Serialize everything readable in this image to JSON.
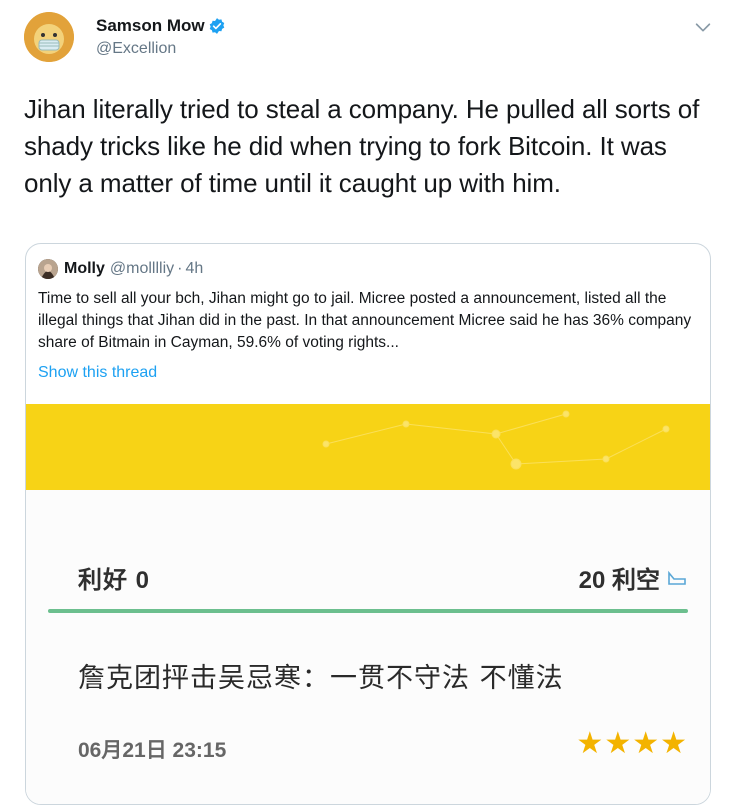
{
  "tweet": {
    "author_name": "Samson Mow",
    "author_handle": "@Excellion",
    "text": "Jihan literally tried to steal a company. He pulled all sorts of shady tricks like he did when trying to fork Bitcoin. It was only a matter of time until it caught up with him."
  },
  "quote": {
    "name": "Molly",
    "handle": "@molllliy",
    "separator": "·",
    "time": "4h",
    "text": "Time to sell all your bch, Jihan might go to jail. Micree posted a announcement, listed all the illegal things that Jihan did in the past. In that announcement Micree said he has 36% company share of Bitmain in Cayman, 59.6% of voting rights...",
    "show_thread": "Show this thread"
  },
  "media": {
    "bull_label": "利好 0",
    "bear_label": "20 利空",
    "headline": "詹克团抨击吴忌寒：一贯不守法 不懂法",
    "date": "06月21日 23:15",
    "stars": "★★★★"
  },
  "colors": {
    "banner": "#f7d316",
    "divider": "#6cbf8e",
    "link": "#1da1f2",
    "verified": "#1da1f2",
    "stars": "#f3b300"
  },
  "icons": {
    "verified": "verified-badge-icon",
    "caret": "chevron-down-icon",
    "bear_icon": "bookmark-icon"
  }
}
